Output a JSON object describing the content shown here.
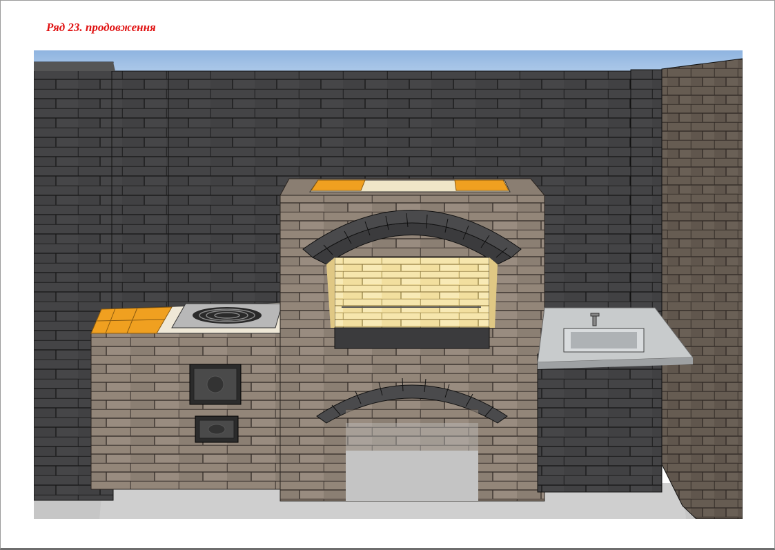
{
  "page": {
    "title": "Ряд 23. продовження"
  },
  "illustration": {
    "subject": "outdoor-brick-kitchen",
    "colors": {
      "sky": "#9fc0e6",
      "dark_brick": "#3b3b3d",
      "light_brick": "#8a7d72",
      "firebrick": "#f2e2a8",
      "orange_tile": "#f0a020",
      "floor": "#c8c8c8",
      "grass": "#3f9a2e",
      "countertop": "#c8cbcc"
    }
  }
}
